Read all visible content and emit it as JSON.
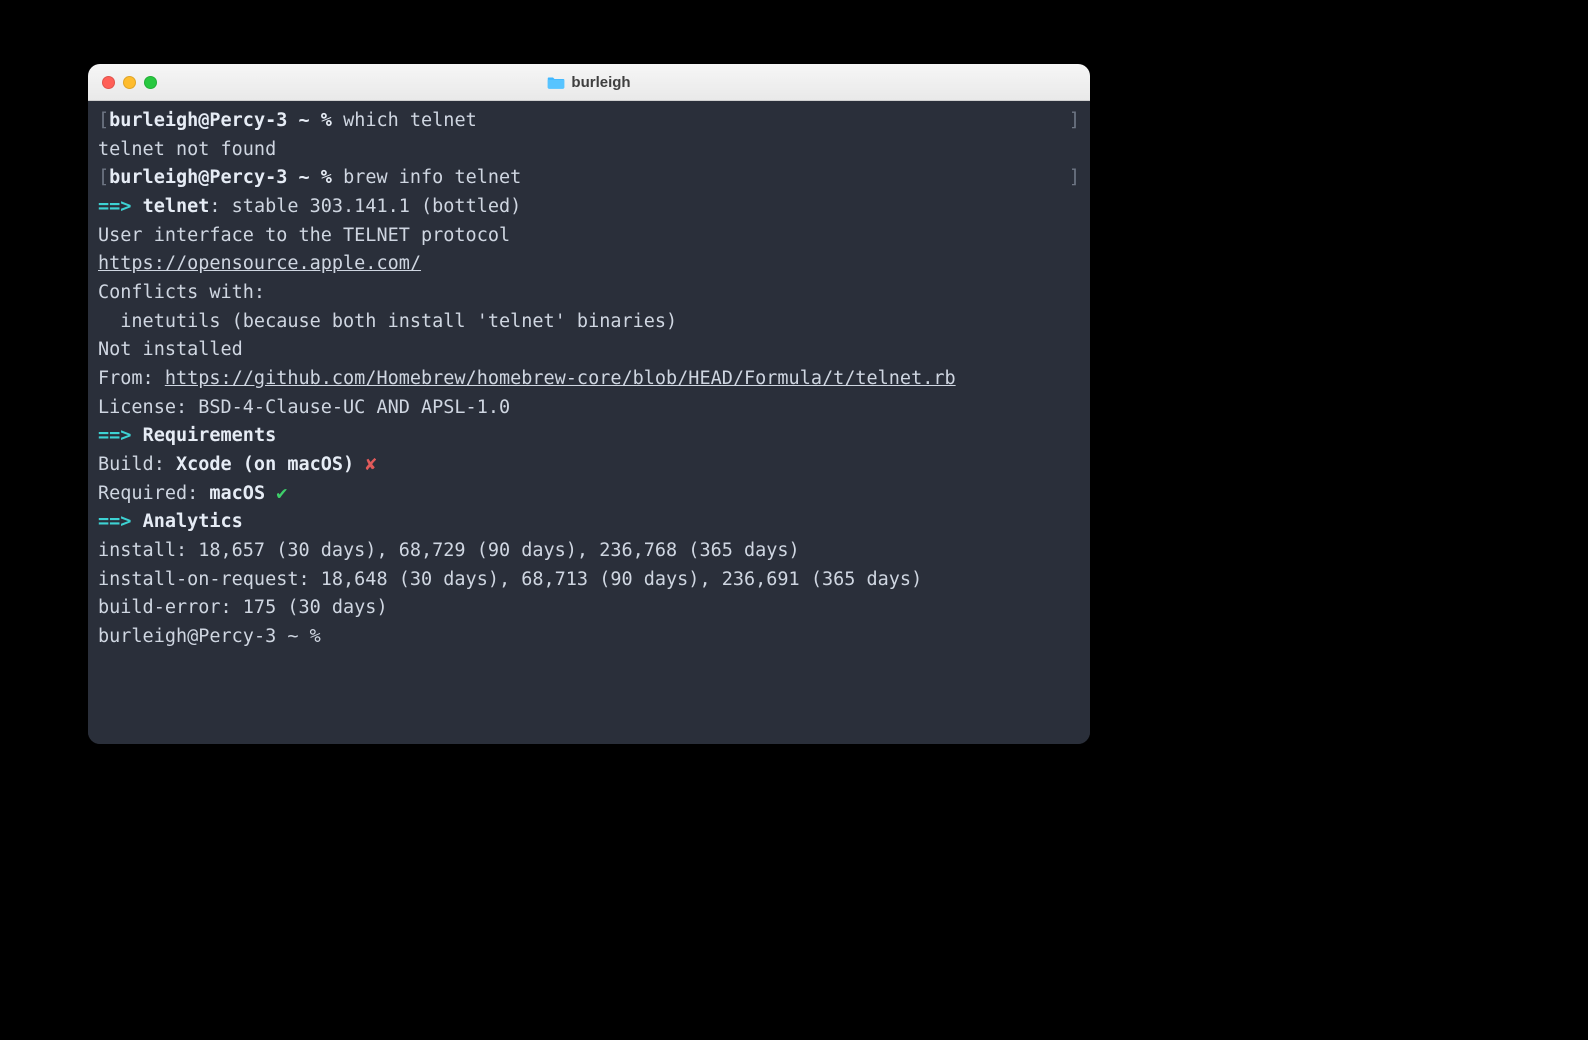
{
  "window": {
    "title": "burleigh",
    "traffic_lights": [
      "close",
      "minimize",
      "zoom"
    ]
  },
  "prompt": {
    "user": "burleigh",
    "host": "Percy-3",
    "dir": "~",
    "sigil": "%",
    "open_bracket": "[",
    "close_bracket": "]"
  },
  "cmd1": "which telnet",
  "cmd1_out": "telnet not found",
  "cmd2": "brew info telnet",
  "arrow": "==>",
  "info": {
    "name_line_prefix": "telnet",
    "name_line_rest": ": stable 303.141.1 (bottled)",
    "desc": "User interface to the TELNET protocol",
    "homepage": "https://opensource.apple.com/",
    "conflicts_label": "Conflicts with:",
    "conflicts_line": "  inetutils (because both install 'telnet' binaries)",
    "not_installed": "Not installed",
    "from_label": "From: ",
    "from_url": "https://github.com/Homebrew/homebrew-core/blob/HEAD/Formula/t/telnet.rb",
    "license": "License: BSD-4-Clause-UC AND APSL-1.0"
  },
  "section_requirements": "Requirements",
  "req_build_label": "Build: ",
  "req_build_value": "Xcode (on macOS)",
  "req_build_mark": "✘",
  "req_required_label": "Required: ",
  "req_required_value": "macOS",
  "req_required_mark": "✔",
  "section_analytics": "Analytics",
  "analytics": {
    "install": "install: 18,657 (30 days), 68,729 (90 days), 236,768 (365 days)",
    "install_on_request": "install-on-request: 18,648 (30 days), 68,713 (90 days), 236,691 (365 days)",
    "build_error": "build-error: 175 (30 days)"
  }
}
